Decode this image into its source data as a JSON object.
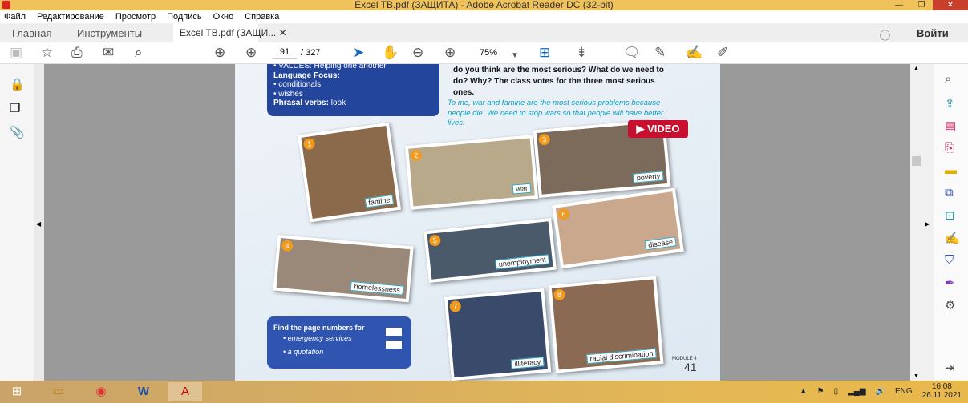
{
  "window": {
    "title": "Excel TB.pdf (ЗАЩИТА) - Adobe Acrobat Reader DC (32-bit)"
  },
  "menu": [
    "Файл",
    "Редактирование",
    "Просмотр",
    "Подпись",
    "Окно",
    "Справка"
  ],
  "tabs": {
    "home": "Главная",
    "tools": "Инструменты",
    "doc": "Excel TB.pdf (ЗАЩИ...",
    "login": "Войти"
  },
  "toolbar": {
    "page_current": "91",
    "page_total": "/ 327",
    "zoom": "75%"
  },
  "page": {
    "box_lines": [
      "• VALUES: Helping one another",
      "Language Focus:",
      "• conditionals",
      "• wishes"
    ],
    "phrasal_label": "Phrasal verbs:",
    "phrasal_value": "look",
    "question": "do you think are the most serious? What do we need to do? Why? The class votes for the three most serious ones.",
    "answer": "To me, war and famine are the most serious problems because people die. We need to stop wars so that people will have better lives.",
    "video": "VIDEO",
    "photos": [
      {
        "n": "1",
        "label": "famine"
      },
      {
        "n": "2",
        "label": "war"
      },
      {
        "n": "3",
        "label": "poverty"
      },
      {
        "n": "4",
        "label": "homelessness"
      },
      {
        "n": "5",
        "label": "unemployment"
      },
      {
        "n": "6",
        "label": "disease"
      },
      {
        "n": "7",
        "label": "illiteracy"
      },
      {
        "n": "8",
        "label": "racial discrimination"
      }
    ],
    "find_title": "Find the page numbers for",
    "find_items": [
      "emergency services",
      "a quotation"
    ],
    "module": "MODULE 4",
    "page_number": "41"
  },
  "tray": {
    "lang": "ENG",
    "time": "16:08",
    "date": "26.11.2021"
  }
}
